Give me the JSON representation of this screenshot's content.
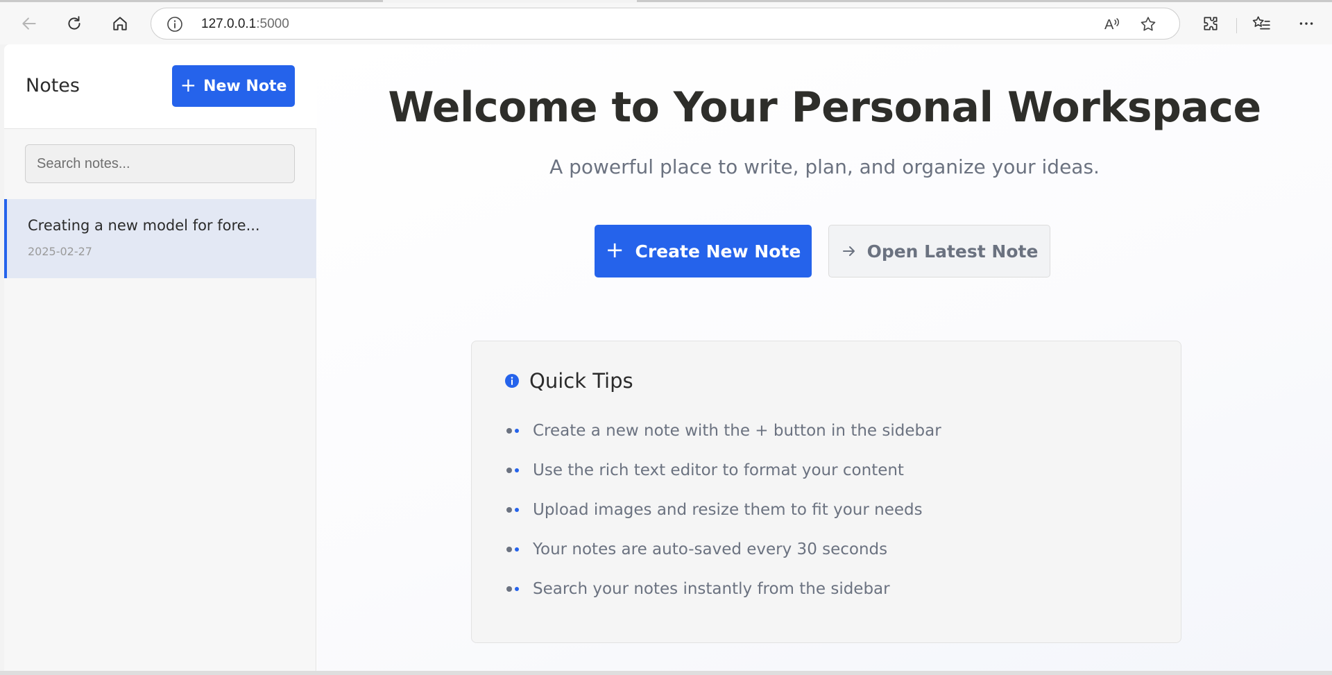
{
  "browser": {
    "url_host": "127.0.0.1",
    "url_port": ":5000"
  },
  "sidebar": {
    "title": "Notes",
    "new_note_label": "New Note",
    "search_placeholder": "Search notes...",
    "notes": [
      {
        "title": "Creating a new model for fore...",
        "date": "2025-02-27"
      }
    ]
  },
  "main": {
    "title": "Welcome to Your Personal Workspace",
    "subtitle": "A powerful place to write, plan, and organize your ideas.",
    "create_label": "Create New Note",
    "open_label": "Open Latest Note",
    "tips": {
      "title": "Quick Tips",
      "items": [
        "Create a new note with the + button in the sidebar",
        "Use the rich text editor to format your content",
        "Upload images and resize them to fit your needs",
        "Your notes are auto-saved every 30 seconds",
        "Search your notes instantly from the sidebar"
      ]
    }
  },
  "colors": {
    "accent": "#2563eb",
    "selected_note_bg": "#e3e8f4",
    "muted_text": "#6b7280"
  }
}
